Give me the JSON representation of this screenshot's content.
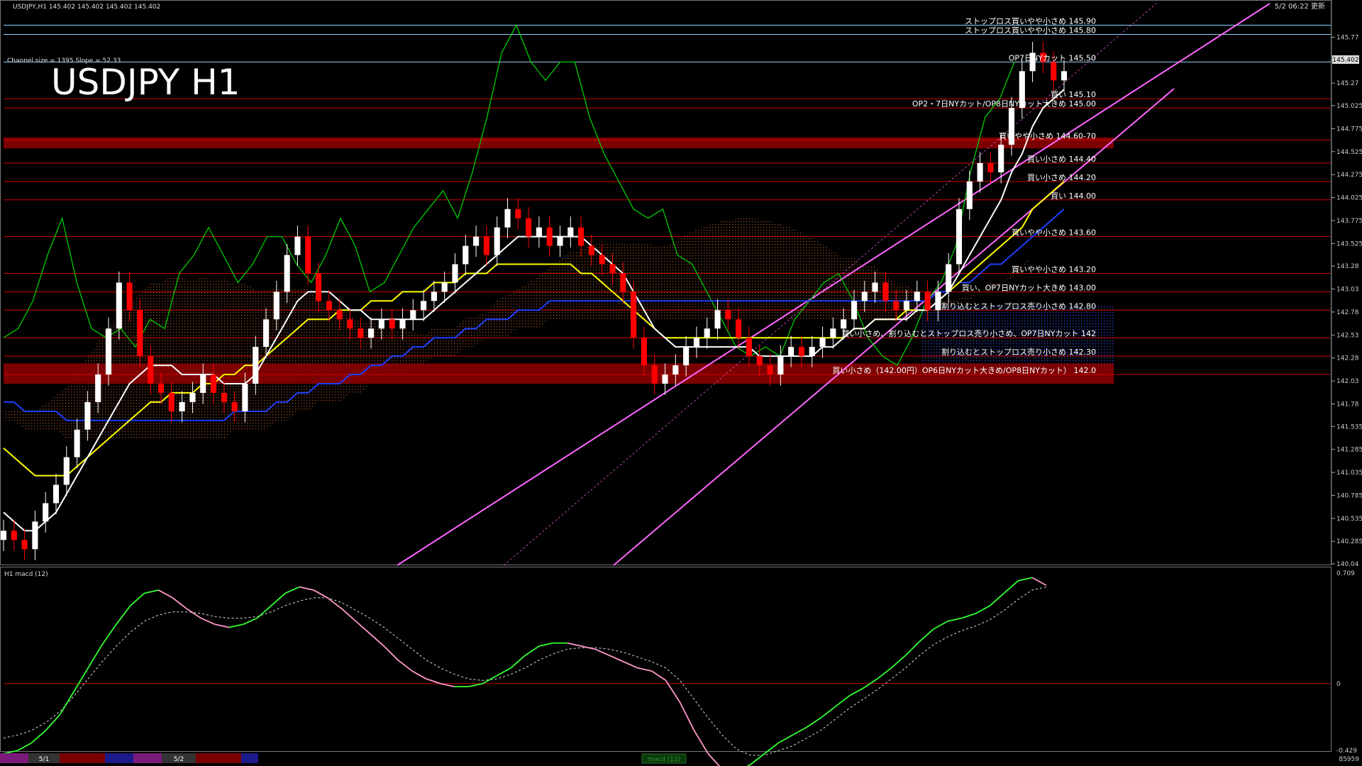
{
  "window": {
    "header_text": "USDJPY,H1  145.402 145.402 145.402 145.402",
    "updated_text": "5/2 06:22 更新",
    "channel_text": "Channel size = 1395 Slope = 52.33",
    "big_title": "USDJPY H1",
    "macd_label": "H1  macd (12)",
    "macd_tab": "macd (12)",
    "bottom_right": "85959",
    "date_tabs": [
      "5/1",
      "5/2"
    ]
  },
  "colors": {
    "background": "#000000",
    "up_candle": "#ffffff",
    "down_candle": "#ff0000",
    "ma_white": "#ffffff",
    "ma_yellow": "#ffff00",
    "ma_blue": "#1f3fff",
    "channel": "#ff66ff",
    "chikou": "#00cc00",
    "macd_main": "#33ff33",
    "macd_neg": "#ff99cc",
    "level_line": "#cc0000"
  },
  "chart_data": {
    "type": "candlestick",
    "symbol": "USDJPY",
    "timeframe": "H1",
    "ylim": [
      140.04,
      146.02
    ],
    "price_ticks": [
      145.77,
      145.52,
      145.27,
      145.025,
      144.775,
      144.525,
      144.275,
      144.025,
      143.775,
      143.525,
      143.28,
      143.03,
      142.78,
      142.53,
      142.28,
      142.03,
      141.78,
      141.535,
      141.285,
      141.035,
      140.785,
      140.535,
      140.285,
      140.04
    ],
    "current_price": 145.402,
    "closes": [
      140.4,
      140.3,
      140.2,
      140.5,
      140.7,
      140.9,
      141.2,
      141.5,
      141.8,
      142.1,
      142.6,
      143.1,
      142.8,
      142.3,
      142.0,
      141.9,
      141.7,
      141.8,
      141.9,
      142.1,
      141.9,
      141.8,
      141.7,
      142.0,
      142.4,
      142.7,
      143.0,
      143.4,
      143.6,
      143.2,
      142.9,
      142.8,
      142.7,
      142.6,
      142.5,
      142.6,
      142.7,
      142.6,
      142.7,
      142.8,
      142.9,
      143.0,
      143.1,
      143.3,
      143.5,
      143.6,
      143.4,
      143.7,
      143.9,
      143.8,
      143.6,
      143.7,
      143.5,
      143.6,
      143.7,
      143.5,
      143.4,
      143.3,
      143.2,
      143.0,
      142.5,
      142.2,
      142.0,
      142.1,
      142.2,
      142.4,
      142.5,
      142.6,
      142.8,
      142.7,
      142.5,
      142.3,
      142.2,
      142.1,
      142.3,
      142.4,
      142.3,
      142.4,
      142.5,
      142.6,
      142.7,
      142.9,
      143.0,
      143.1,
      142.9,
      142.8,
      142.9,
      143.0,
      142.8,
      143.0,
      143.3,
      143.9,
      144.2,
      144.4,
      144.3,
      144.6,
      145.0,
      145.4,
      145.6,
      145.5,
      145.3,
      145.4
    ],
    "ma_white": [
      140.6,
      140.5,
      140.4,
      140.4,
      140.5,
      140.6,
      140.8,
      141.0,
      141.2,
      141.4,
      141.6,
      141.8,
      142.0,
      142.1,
      142.2,
      142.2,
      142.2,
      142.1,
      142.1,
      142.1,
      142.1,
      142.0,
      142.0,
      142.0,
      142.1,
      142.3,
      142.5,
      142.7,
      142.9,
      143.0,
      143.0,
      143.0,
      142.9,
      142.8,
      142.8,
      142.7,
      142.7,
      142.7,
      142.7,
      142.7,
      142.7,
      142.8,
      142.9,
      143.0,
      143.1,
      143.2,
      143.3,
      143.4,
      143.5,
      143.6,
      143.6,
      143.6,
      143.6,
      143.6,
      143.6,
      143.6,
      143.5,
      143.4,
      143.3,
      143.2,
      143.0,
      142.8,
      142.6,
      142.5,
      142.4,
      142.4,
      142.4,
      142.4,
      142.4,
      142.4,
      142.4,
      142.4,
      142.3,
      142.3,
      142.3,
      142.3,
      142.3,
      142.3,
      142.4,
      142.4,
      142.5,
      142.6,
      142.6,
      142.7,
      142.7,
      142.7,
      142.7,
      142.8,
      142.8,
      142.9,
      143.0,
      143.2,
      143.4,
      143.6,
      143.8,
      144.0,
      144.3,
      144.5,
      144.8,
      145.0,
      145.1,
      145.2
    ],
    "ma_yellow": [
      141.3,
      141.2,
      141.1,
      141.0,
      141.0,
      141.0,
      141.0,
      141.1,
      141.2,
      141.3,
      141.4,
      141.5,
      141.6,
      141.7,
      141.8,
      141.8,
      141.9,
      141.9,
      141.9,
      142.0,
      142.0,
      142.1,
      142.1,
      142.2,
      142.2,
      142.3,
      142.4,
      142.5,
      142.6,
      142.7,
      142.7,
      142.7,
      142.8,
      142.8,
      142.8,
      142.9,
      142.9,
      142.9,
      143.0,
      143.0,
      143.0,
      143.1,
      143.1,
      143.1,
      143.2,
      143.2,
      143.2,
      143.3,
      143.3,
      143.3,
      143.3,
      143.3,
      143.3,
      143.3,
      143.3,
      143.2,
      143.2,
      143.1,
      143.0,
      142.9,
      142.8,
      142.7,
      142.6,
      142.5,
      142.5,
      142.5,
      142.5,
      142.5,
      142.5,
      142.5,
      142.5,
      142.5,
      142.5,
      142.5,
      142.5,
      142.5,
      142.5,
      142.5,
      142.5,
      142.5,
      142.5,
      142.6,
      142.6,
      142.7,
      142.7,
      142.7,
      142.8,
      142.8,
      142.8,
      142.9,
      143.0,
      143.1,
      143.2,
      143.3,
      143.4,
      143.5,
      143.6,
      143.7,
      143.9,
      144.0,
      144.1,
      144.2
    ],
    "ma_blue": [
      141.8,
      141.8,
      141.7,
      141.7,
      141.7,
      141.7,
      141.6,
      141.6,
      141.6,
      141.6,
      141.6,
      141.6,
      141.6,
      141.6,
      141.6,
      141.6,
      141.6,
      141.6,
      141.6,
      141.6,
      141.6,
      141.6,
      141.7,
      141.7,
      141.7,
      141.7,
      141.8,
      141.8,
      141.9,
      141.9,
      142.0,
      142.0,
      142.0,
      142.1,
      142.1,
      142.2,
      142.2,
      142.3,
      142.3,
      142.4,
      142.4,
      142.5,
      142.5,
      142.5,
      142.6,
      142.6,
      142.7,
      142.7,
      142.7,
      142.8,
      142.8,
      142.8,
      142.9,
      142.9,
      142.9,
      142.9,
      142.9,
      142.9,
      142.9,
      142.9,
      142.9,
      142.9,
      142.9,
      142.9,
      142.9,
      142.9,
      142.9,
      142.9,
      142.9,
      142.9,
      142.9,
      142.9,
      142.9,
      142.9,
      142.9,
      142.9,
      142.9,
      142.9,
      142.9,
      142.9,
      142.9,
      142.9,
      142.9,
      142.9,
      142.9,
      142.9,
      142.9,
      142.9,
      142.9,
      143.0,
      143.0,
      143.1,
      143.1,
      143.2,
      143.3,
      143.3,
      143.4,
      143.5,
      143.6,
      143.7,
      143.8,
      143.9
    ],
    "chikou": [
      142.5,
      142.6,
      142.9,
      143.4,
      143.8,
      143.1,
      142.6,
      142.5,
      142.6,
      142.4,
      142.7,
      142.6,
      143.2,
      143.4,
      143.7,
      143.4,
      143.1,
      143.3,
      143.6,
      143.6,
      143.3,
      143.1,
      143.4,
      143.8,
      143.5,
      143.0,
      143.1,
      143.4,
      143.7,
      143.9,
      144.1,
      143.8,
      144.3,
      144.9,
      145.6,
      145.9,
      145.5,
      145.3,
      145.5,
      145.5,
      144.9,
      144.5,
      144.2,
      143.9,
      143.8,
      143.9,
      143.4,
      143.3,
      143.0,
      142.7,
      142.4,
      142.3,
      142.4,
      142.3,
      142.7,
      142.9,
      143.1,
      143.2,
      142.9,
      142.5,
      142.3,
      142.2,
      142.5,
      142.9,
      143.1,
      143.5,
      144.3,
      144.9,
      145.1,
      145.5
    ],
    "levels": [
      {
        "price": 145.9,
        "label": "ストップロス買いやや小さめ 145.90",
        "color": "#8fd3ff"
      },
      {
        "price": 145.8,
        "label": "ストップロス買いやや小さめ 145.80",
        "color": "#8fd3ff"
      },
      {
        "price": 145.5,
        "label": "OP7日NYカット 145.50",
        "color": "#8fd3ff"
      },
      {
        "price": 145.1,
        "label": "買い 145.10",
        "color": "#cc0000"
      },
      {
        "price": 145.0,
        "label": "OP2・7日NYカット/OP8日NYカット大きめ 145.00",
        "color": "#cc0000"
      },
      {
        "price": 144.65,
        "label": "買いやや小さめ 144.60-70",
        "color": "#cc0000"
      },
      {
        "price": 144.4,
        "label": "買い小さめ 144.40",
        "color": "#cc0000"
      },
      {
        "price": 144.2,
        "label": "買い小さめ 144.20",
        "color": "#cc0000"
      },
      {
        "price": 144.0,
        "label": "買い 144.00",
        "color": "#cc0000"
      },
      {
        "price": 143.6,
        "label": "買いやや小さめ 143.60",
        "color": "#cc0000"
      },
      {
        "price": 143.2,
        "label": "買いやや小さめ 143.20",
        "color": "#cc0000"
      },
      {
        "price": 143.0,
        "label": "買い、OP7日NYカット大きめ 143.00",
        "color": "#cc0000"
      },
      {
        "price": 142.8,
        "label": "割り込むとストップロス売り小さめ 142.80",
        "color": "#cc0000"
      },
      {
        "price": 142.5,
        "label": "買い小さめ、割り込むとストップロス売り小さめ、OP7日NYカット 142",
        "color": "#cc0000"
      },
      {
        "price": 142.3,
        "label": "割り込むとストップロス売り小さめ 142.30",
        "color": "#cc0000"
      },
      {
        "price": 142.1,
        "label": "買い小さめ（142.00円）OP6日NYカット大きめ/OP8日NYカット） 142.0",
        "color": "#cc0000"
      }
    ],
    "macd": {
      "label": "H1  macd (12)",
      "ylim": [
        -0.429,
        0.709
      ],
      "ticks": [
        0.709,
        0.0,
        -0.429
      ],
      "main": [
        -0.45,
        -0.43,
        -0.38,
        -0.3,
        -0.2,
        -0.05,
        0.1,
        0.25,
        0.38,
        0.5,
        0.58,
        0.6,
        0.55,
        0.48,
        0.42,
        0.38,
        0.36,
        0.38,
        0.42,
        0.5,
        0.58,
        0.62,
        0.6,
        0.55,
        0.48,
        0.4,
        0.32,
        0.24,
        0.15,
        0.08,
        0.03,
        0.0,
        -0.02,
        -0.02,
        0.0,
        0.05,
        0.1,
        0.18,
        0.24,
        0.26,
        0.26,
        0.24,
        0.22,
        0.18,
        0.14,
        0.1,
        0.08,
        0.02,
        -0.12,
        -0.3,
        -0.45,
        -0.55,
        -0.57,
        -0.52,
        -0.45,
        -0.38,
        -0.33,
        -0.28,
        -0.22,
        -0.15,
        -0.08,
        -0.03,
        0.03,
        0.1,
        0.18,
        0.27,
        0.35,
        0.4,
        0.42,
        0.45,
        0.5,
        0.58,
        0.66,
        0.68,
        0.63
      ],
      "signal": [
        -0.35,
        -0.33,
        -0.3,
        -0.25,
        -0.18,
        -0.08,
        0.03,
        0.14,
        0.24,
        0.33,
        0.4,
        0.44,
        0.46,
        0.46,
        0.45,
        0.43,
        0.42,
        0.42,
        0.43,
        0.46,
        0.5,
        0.53,
        0.55,
        0.55,
        0.52,
        0.47,
        0.42,
        0.36,
        0.29,
        0.22,
        0.15,
        0.1,
        0.06,
        0.03,
        0.02,
        0.03,
        0.06,
        0.1,
        0.15,
        0.19,
        0.22,
        0.23,
        0.23,
        0.22,
        0.2,
        0.17,
        0.14,
        0.1,
        0.02,
        -0.1,
        -0.22,
        -0.33,
        -0.42,
        -0.46,
        -0.46,
        -0.43,
        -0.4,
        -0.35,
        -0.3,
        -0.23,
        -0.16,
        -0.1,
        -0.04,
        0.03,
        0.1,
        0.18,
        0.25,
        0.3,
        0.34,
        0.37,
        0.41,
        0.47,
        0.54,
        0.6,
        0.62
      ]
    }
  }
}
